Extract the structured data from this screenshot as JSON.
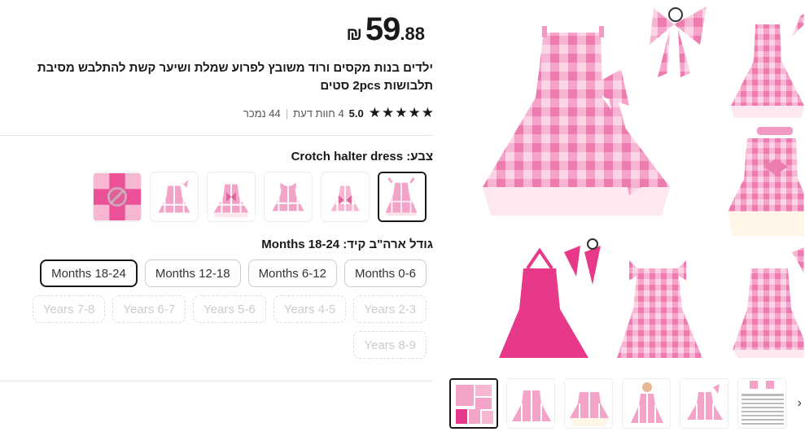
{
  "product": {
    "price": {
      "integer": "59",
      "decimal": ".88",
      "currency": "₪"
    },
    "title": "ילדים בנות מקסים ורוד משובץ לפרוע שמלת ושיער קשת להתלבש מסיבת תלבושות 2pcs סטים",
    "rating": {
      "score": "5.0",
      "reviews": "4 חוות דעת",
      "sold": "44 נמכר",
      "separator": "|"
    }
  },
  "color": {
    "label": "צבע: Crotch halter dress",
    "swatches": [
      "swatch-1",
      "swatch-2",
      "swatch-3",
      "swatch-4",
      "swatch-5",
      "swatch-6"
    ]
  },
  "size": {
    "label": "גודל ארה\"ב קיד: Months 18-24",
    "options": [
      {
        "label": "Months 0-6",
        "state": "normal"
      },
      {
        "label": "Months 6-12",
        "state": "normal"
      },
      {
        "label": "Months 12-18",
        "state": "normal"
      },
      {
        "label": "Months 18-24",
        "state": "selected"
      },
      {
        "label": "Years 2-3",
        "state": "disabled"
      },
      {
        "label": "Years 4-5",
        "state": "disabled"
      },
      {
        "label": "Years 5-6",
        "state": "disabled"
      },
      {
        "label": "Years 6-7",
        "state": "disabled"
      },
      {
        "label": "Years 7-8",
        "state": "disabled"
      },
      {
        "label": "Years 8-9",
        "state": "disabled"
      }
    ]
  },
  "gallery": {
    "thumbnail_count": 6,
    "next_icon": "chevron-right-icon"
  },
  "colors": {
    "pink": "#f4a3c8",
    "pink_light": "#fbd5e6",
    "hot_pink": "#e8388a",
    "text": "#191919"
  }
}
